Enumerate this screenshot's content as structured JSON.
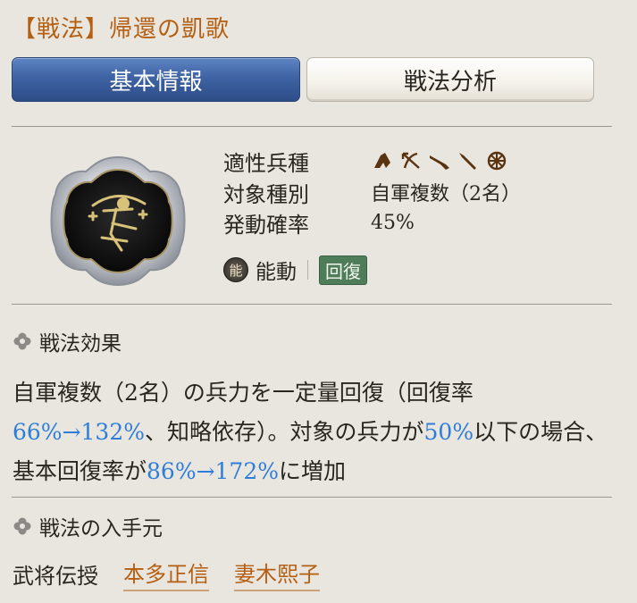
{
  "header": {
    "title": "【戦法】帰還の凱歌"
  },
  "tabs": [
    {
      "label": "基本情報",
      "active": true
    },
    {
      "label": "戦法分析",
      "active": false
    }
  ],
  "info": {
    "unit_type_label": "適性兵種",
    "unit_icons": [
      "cavalry-icon",
      "bow-icon",
      "gun-icon",
      "spear-icon",
      "siege-wheel-icon"
    ],
    "target_label": "対象種別",
    "target_value": "自軍複数（2名）",
    "rate_label": "発動確率",
    "rate_value": "45%",
    "active_badge": "能",
    "active_label": "能動",
    "tag": "回復"
  },
  "effect": {
    "heading": "戦法効果",
    "segments": [
      {
        "text": "自軍複数（2名）の兵力を一定量回復（回復率",
        "highlight": false
      },
      {
        "text": "66%→132%",
        "highlight": true
      },
      {
        "text": "、知略依存）。対象の兵力が",
        "highlight": false
      },
      {
        "text": "50%",
        "highlight": true
      },
      {
        "text": "以下の場合、基本回復率が",
        "highlight": false
      },
      {
        "text": "86%→172%",
        "highlight": true
      },
      {
        "text": "に増加",
        "highlight": false
      }
    ]
  },
  "source": {
    "heading": "戦法の入手元",
    "label": "武将伝授",
    "generals": [
      "本多正信",
      "妻木熙子"
    ]
  },
  "colors": {
    "accent_orange": "#b45f12",
    "highlight_blue": "#2e7ed9",
    "tab_active": "#3f63a3",
    "tag_green": "#4f7d5a"
  }
}
